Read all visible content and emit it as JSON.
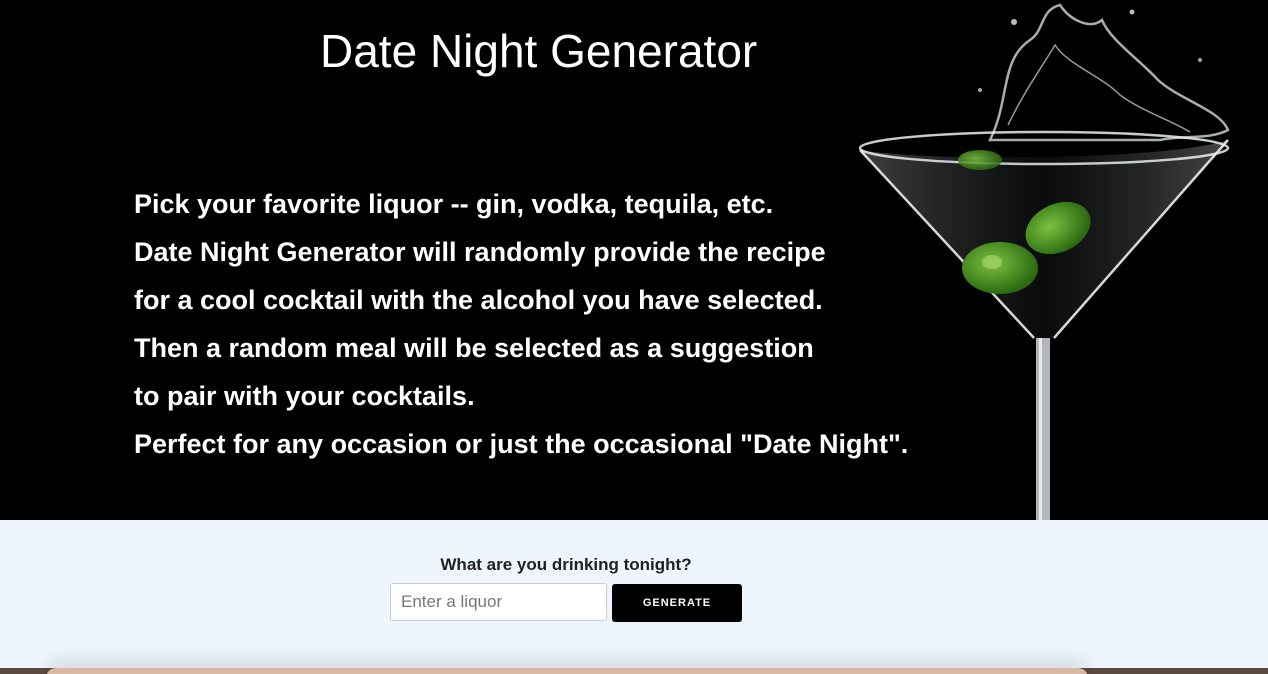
{
  "header": {
    "title": "Date Night Generator"
  },
  "intro": {
    "lines": [
      "Pick your favorite liquor -- gin, vodka, tequila, etc.",
      "Date Night Generator will randomly provide the recipe",
      "for a cool cocktail with the alcohol you have selected.",
      "Then a random meal will be selected as a suggestion",
      "to pair with your cocktails.",
      "Perfect for any occasion or just the occasional \"Date Night\"."
    ]
  },
  "hero_image": {
    "icon": "martini-glass-splash-icon"
  },
  "form": {
    "prompt": "What are you drinking tonight?",
    "input_value": "",
    "input_placeholder": "Enter a liquor",
    "button_label": "Generate"
  },
  "colors": {
    "hero_background": "#000000",
    "page_background": "#eef5fd",
    "button_background": "#000000",
    "olive": "#3f8a1c"
  }
}
